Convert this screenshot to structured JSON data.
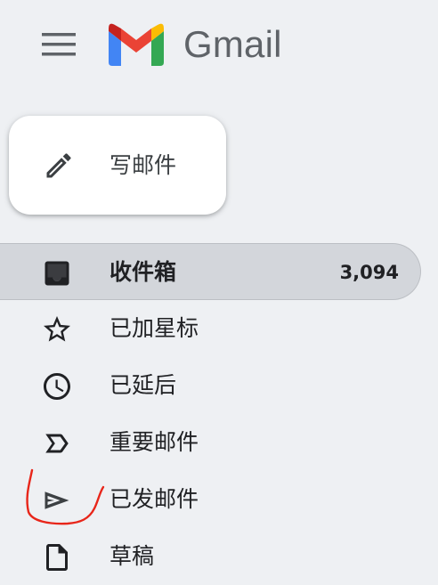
{
  "header": {
    "app_name": "Gmail",
    "menu_icon": "hamburger-menu-icon",
    "logo_icon": "gmail-m-logo"
  },
  "compose": {
    "label": "写邮件",
    "icon": "pencil-icon"
  },
  "nav": {
    "items": [
      {
        "label": "收件箱",
        "count": "3,094",
        "icon": "inbox-icon",
        "active": true
      },
      {
        "label": "已加星标",
        "icon": "star-icon"
      },
      {
        "label": "已延后",
        "icon": "clock-icon"
      },
      {
        "label": "重要邮件",
        "icon": "important-label-icon"
      },
      {
        "label": "已发邮件",
        "icon": "send-icon"
      },
      {
        "label": "草稿",
        "icon": "draft-file-icon"
      }
    ]
  },
  "colors": {
    "background": "#eef0f3",
    "active_item": "#d3d6db",
    "annotation": "#e8261a",
    "gmail_red": "#ea4335",
    "gmail_blue": "#4285f4",
    "gmail_green": "#34a853",
    "gmail_yellow": "#fbbc04"
  }
}
